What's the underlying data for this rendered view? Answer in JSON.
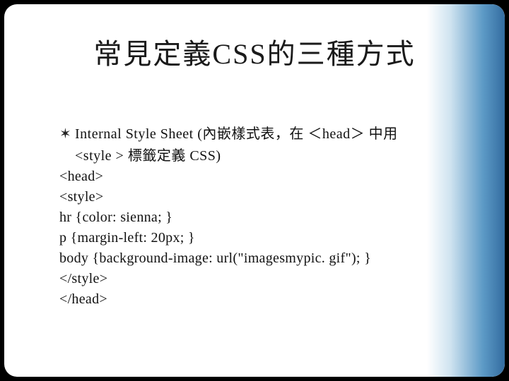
{
  "slide": {
    "title": "常見定義CSS的三種方式",
    "bullet_marker": "✶",
    "bullet_line1": "Internal Style Sheet (內嵌樣式表，在 ＜head＞ 中用",
    "bullet_line2": "<style > 標籤定義 CSS)",
    "code": {
      "l1": "<head>",
      "l2": "<style>",
      "l3": "hr {color: sienna; }",
      "l4": "p {margin-left: 20px; }",
      "l5": "body {background-image: url(\"imagesmypic. gif\"); }",
      "l6": "</style>",
      "l7": "</head>"
    }
  }
}
